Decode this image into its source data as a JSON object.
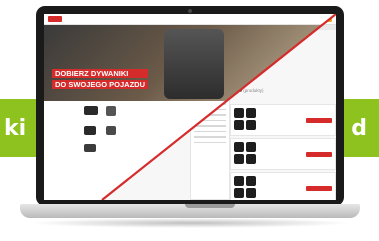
{
  "bands": {
    "left_text": "ki",
    "right_text": "d"
  },
  "hero": {
    "line1": "DOBIERZ DYWANIKI",
    "line2": "DO SWOJEGO POJAZDU"
  },
  "listing": {
    "heading": "Dywaniki samochodowe",
    "subheading": "(produkty)"
  },
  "colors": {
    "accent_green": "#8dc21f",
    "brand_red": "#d62b2b",
    "cart_orange": "#f5a623"
  }
}
